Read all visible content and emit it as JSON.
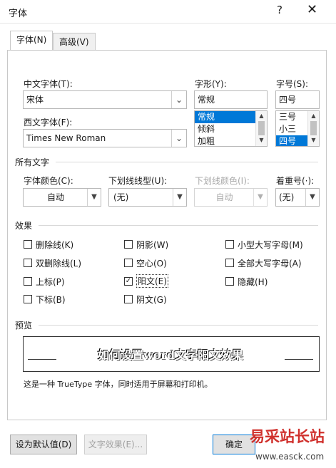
{
  "dialog": {
    "title": "字体",
    "help": "?",
    "close": "✕"
  },
  "tabs": [
    "字体(N)",
    "高级(V)"
  ],
  "font": {
    "chinese_label": "中文字体(T):",
    "chinese_value": "宋体",
    "western_label": "西文字体(F):",
    "western_value": "Times New Roman",
    "style_label": "字形(Y):",
    "style_value": "常规",
    "style_options": [
      "常规",
      "倾斜",
      "加粗"
    ],
    "size_label": "字号(S):",
    "size_value": "四号",
    "size_options": [
      "三号",
      "小三",
      "四号"
    ]
  },
  "all_text": {
    "section_label": "所有文字",
    "color_label": "字体颜色(C):",
    "color_value": "自动",
    "underline_label": "下划线线型(U):",
    "underline_value": "(无)",
    "underline_color_label": "下划线颜色(I):",
    "underline_color_value": "自动",
    "emphasis_label": "着重号(·):",
    "emphasis_value": "(无)"
  },
  "effects": {
    "section_label": "效果",
    "items": [
      {
        "label": "删除线(K)",
        "checked": false
      },
      {
        "label": "阴影(W)",
        "checked": false
      },
      {
        "label": "小型大写字母(M)",
        "checked": false
      },
      {
        "label": "双删除线(L)",
        "checked": false
      },
      {
        "label": "空心(O)",
        "checked": false
      },
      {
        "label": "全部大写字母(A)",
        "checked": false
      },
      {
        "label": "上标(P)",
        "checked": false
      },
      {
        "label": "阳文(E)",
        "checked": true
      },
      {
        "label": "隐藏(H)",
        "checked": false
      },
      {
        "label": "下标(B)",
        "checked": false
      },
      {
        "label": "阴文(G)",
        "checked": false
      }
    ]
  },
  "preview": {
    "section_label": "预览",
    "text": "如何设置word文字阳文效果",
    "note": "这是一种 TrueType 字体，同时适用于屏幕和打印机。"
  },
  "buttons": {
    "default": "设为默认值(D)",
    "text_effects": "文字效果(E)...",
    "ok": "确定"
  },
  "watermark": {
    "text": "易采站长站",
    "url": "www.easck.com"
  },
  "colors": {
    "accent": "#0078d7",
    "watermark": "#d0312d"
  }
}
